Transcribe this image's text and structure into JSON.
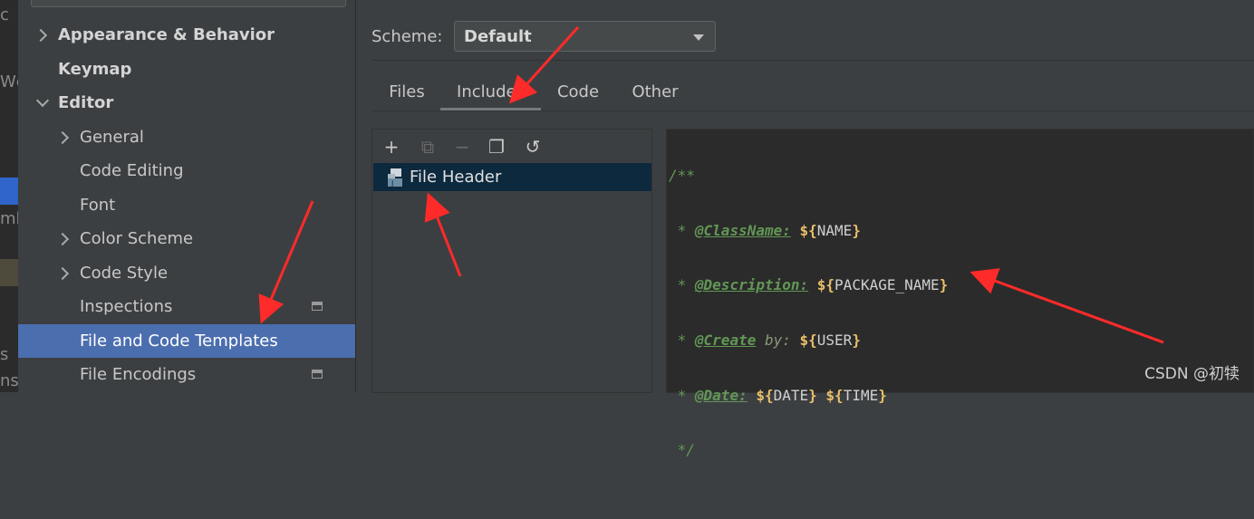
{
  "left_strip": {
    "fragments": [
      "c",
      "Wc",
      "ml",
      "s",
      "ns"
    ]
  },
  "sidebar": {
    "items": [
      {
        "label": "Appearance & Behavior",
        "expandable": "collapsed",
        "bold": true
      },
      {
        "label": "Keymap",
        "bold": true
      },
      {
        "label": "Editor",
        "expandable": "expanded",
        "bold": true
      },
      {
        "label": "General",
        "expandable": "collapsed"
      },
      {
        "label": "Code Editing"
      },
      {
        "label": "Font"
      },
      {
        "label": "Color Scheme",
        "expandable": "collapsed"
      },
      {
        "label": "Code Style",
        "expandable": "collapsed"
      },
      {
        "label": "Inspections",
        "icon": "project-icon"
      },
      {
        "label": "File and Code Templates",
        "selected": true
      },
      {
        "label": "File Encodings",
        "icon": "project-icon"
      }
    ]
  },
  "scheme": {
    "label": "Scheme:",
    "value": "Default"
  },
  "tabs": [
    {
      "label": "Files"
    },
    {
      "label": "Includes",
      "active": true
    },
    {
      "label": "Code"
    },
    {
      "label": "Other"
    }
  ],
  "toolbar": {
    "add": "+",
    "copy_disabled": "⧉",
    "remove": "−",
    "duplicate": "❐",
    "reset": "↺"
  },
  "templates": [
    {
      "name": "File Header",
      "selected": true
    }
  ],
  "editor": {
    "lines": [
      {
        "prefix": "/**"
      },
      {
        "prefix": " * ",
        "tag": "@ClassName:",
        "var": "NAME"
      },
      {
        "prefix": " * ",
        "tag": "@Description:",
        "var": "PACKAGE_NAME"
      },
      {
        "prefix": " * ",
        "tag": "@Create",
        "mid": " by:",
        "var": "USER"
      },
      {
        "prefix": " * ",
        "tag": "@Date:",
        "var": "DATE",
        "var2": "TIME"
      },
      {
        "prefix": " */"
      }
    ]
  },
  "watermark": "CSDN @初犊",
  "colors": {
    "selection": "#4b6eaf",
    "annotation_arrow": "#ff2a2a",
    "comment_green": "#629755"
  }
}
